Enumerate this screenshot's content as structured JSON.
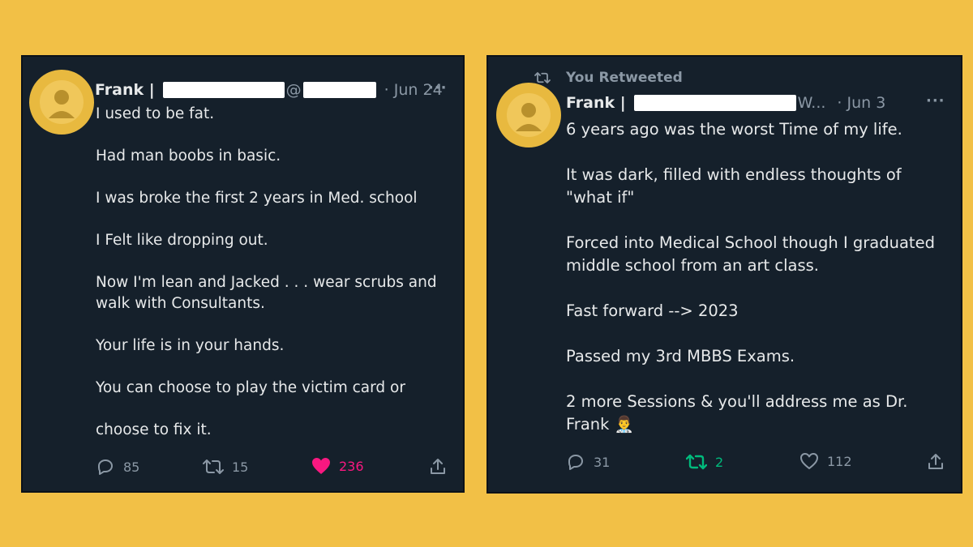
{
  "colors": {
    "page_background": "#f2c046",
    "card_background": "#15202b",
    "text_primary": "#e7e9ea",
    "text_secondary": "#8b98a5",
    "like_active": "#f91880",
    "retweet_active": "#00ba7c"
  },
  "tweet_left": {
    "author": "Frank |",
    "handle_fragment": "@",
    "date": "· Jun 24",
    "more": "···",
    "lines": [
      "I used to be fat.",
      "Had man boobs in basic.",
      "I was broke the first 2 years in Med. school",
      "I Felt like dropping out.",
      "Now I'm lean and Jacked . . . wear scrubs and walk with Consultants.",
      "Your life is in your hands.",
      "You can choose to play the victim card or",
      "choose to fix it."
    ],
    "actions": {
      "reply_icon": "reply-icon",
      "reply_count": "85",
      "retweet_icon": "retweet-icon",
      "retweet_count": "15",
      "like_icon": "heart-filled-icon",
      "like_count": "236",
      "share_icon": "share-icon"
    }
  },
  "tweet_right": {
    "retweeted_label": "You Retweeted",
    "author": "Frank |",
    "handle_fragment": "W...",
    "date": "· Jun 3",
    "more": "···",
    "lines": [
      "6 years ago was the worst Time of my life.",
      "It was dark, filled with endless thoughts of \"what if\"",
      "Forced into Medical School though I graduated middle school from an art class.",
      "Fast forward --> 2023",
      "Passed my 3rd MBBS Exams.",
      "2 more Sessions & you'll address me as Dr. Frank 👨‍⚕️"
    ],
    "actions": {
      "reply_icon": "reply-icon",
      "reply_count": "31",
      "retweet_icon": "retweet-icon",
      "retweet_count": "2",
      "like_icon": "heart-outline-icon",
      "like_count": "112",
      "share_icon": "share-icon"
    }
  }
}
